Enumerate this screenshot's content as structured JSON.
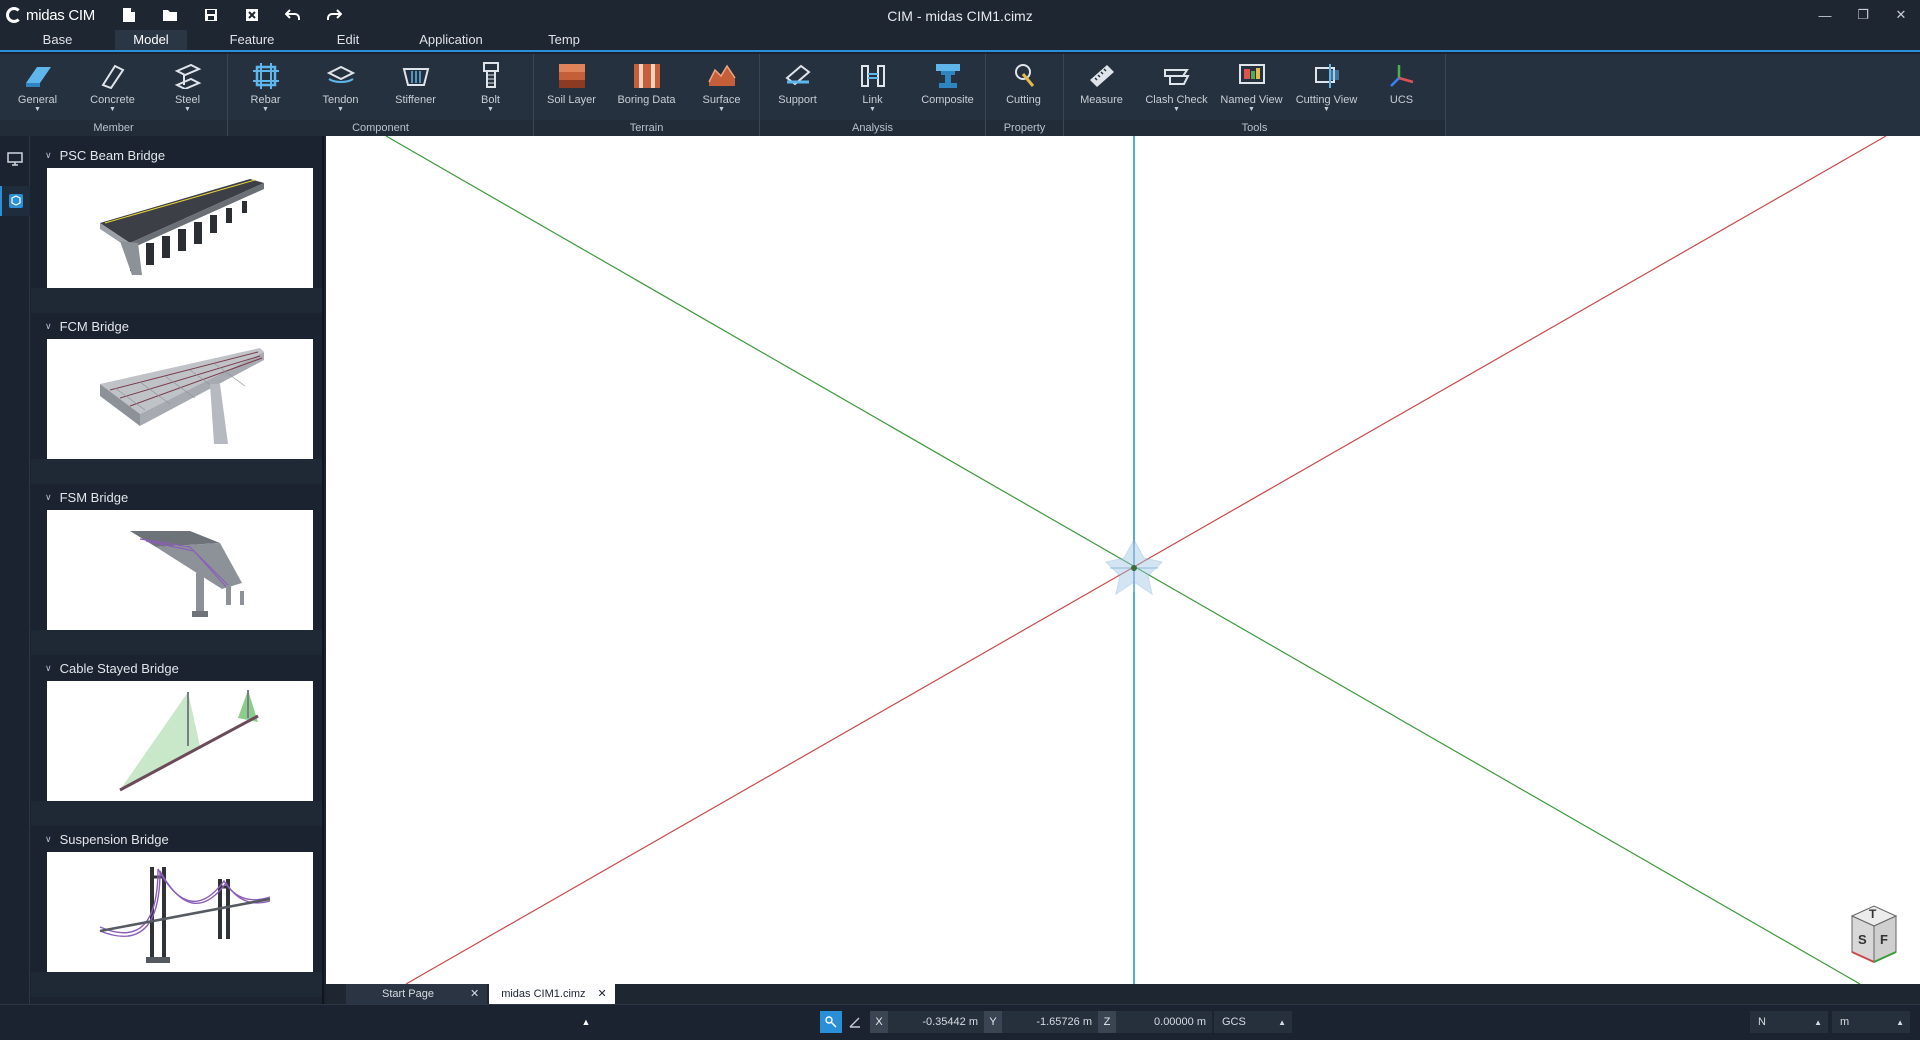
{
  "app": {
    "logo_text": "midas CIM",
    "window_title": "CIM - midas CIM1.cimz"
  },
  "menu": {
    "tabs": [
      "Base",
      "Model",
      "Feature",
      "Edit",
      "Application",
      "Temp"
    ],
    "active": "Model"
  },
  "ribbon": {
    "groups": [
      {
        "label": "Member",
        "buttons": [
          "General",
          "Concrete",
          "Steel"
        ]
      },
      {
        "label": "Component",
        "buttons": [
          "Rebar",
          "Tendon",
          "Stiffener",
          "Bolt"
        ]
      },
      {
        "label": "Terrain",
        "buttons": [
          "Soil Layer",
          "Boring Data",
          "Surface"
        ]
      },
      {
        "label": "Analysis",
        "buttons": [
          "Support",
          "Link",
          "Composite"
        ]
      },
      {
        "label": "Property",
        "buttons": [
          "Cutting"
        ]
      },
      {
        "label": "Tools",
        "buttons": [
          "Measure",
          "Clash Check",
          "Named View",
          "Cutting View",
          "UCS"
        ]
      }
    ]
  },
  "templates": [
    {
      "title": "PSC Beam Bridge"
    },
    {
      "title": "FCM Bridge"
    },
    {
      "title": "FSM Bridge"
    },
    {
      "title": "Cable Stayed Bridge"
    },
    {
      "title": "Suspension Bridge"
    }
  ],
  "doc_tabs": [
    {
      "label": "Start Page",
      "active": false
    },
    {
      "label": "midas CIM1.cimz",
      "active": true
    }
  ],
  "status": {
    "x_label": "X",
    "x_value": "-0.35442 m",
    "y_label": "Y",
    "y_value": "-1.65726 m",
    "z_label": "Z",
    "z_value": "0.00000 m",
    "coord_system": "GCS",
    "force_unit": "N",
    "length_unit": "m"
  },
  "viewcube": {
    "top": "T",
    "left": "S",
    "front": "F"
  },
  "colors": {
    "accent": "#2a8fd6",
    "axis_x": "#c94a4a",
    "axis_y": "#3c9a3c",
    "axis_z": "#1f8fc4"
  }
}
